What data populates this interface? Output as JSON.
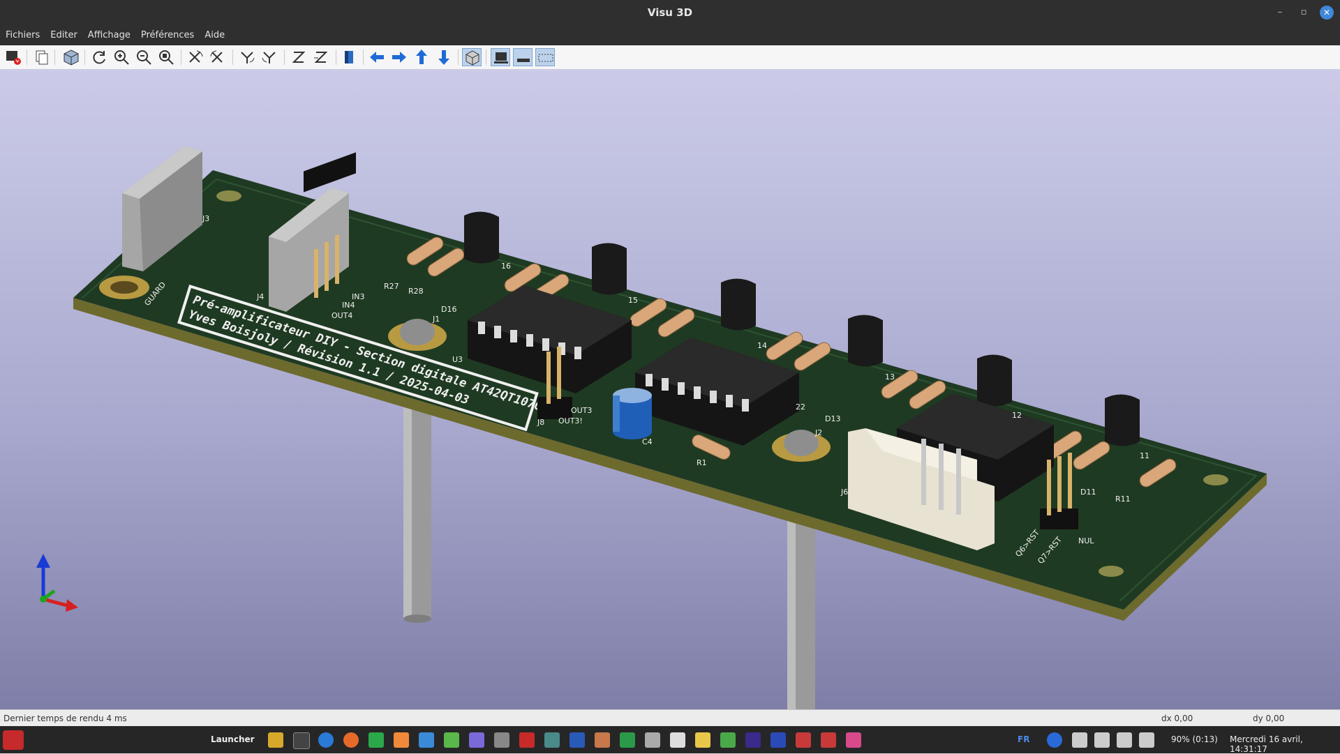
{
  "window": {
    "title": "Visu 3D",
    "minimize": "–",
    "restore": "▫",
    "close": "✕"
  },
  "menu": [
    "Fichiers",
    "Editer",
    "Affichage",
    "Préférences",
    "Aide"
  ],
  "toolbar": {
    "buttons": [
      "export-icon",
      "copy-icon",
      "view-3d-icon",
      "reload-icon",
      "zoom-in-icon",
      "zoom-out-icon",
      "zoom-fit-icon",
      "rotate-x-cw-icon",
      "rotate-x-ccw-icon",
      "rotate-y-cw-icon",
      "rotate-y-ccw-icon",
      "rotate-z-cw-icon",
      "rotate-z-ccw-icon",
      "flip-board-icon",
      "move-left-icon",
      "move-right-icon",
      "move-up-icon",
      "move-down-icon",
      "orthographic-icon",
      "render-realistic-icon",
      "render-board-icon",
      "render-bbox-icon"
    ]
  },
  "board": {
    "silkscreen_line1": "Pré-amplificateur DIY - Section digitale AT42QT1070",
    "silkscreen_line2": "Yves Boisjoly / Révision 1.1 / 2025-04-03",
    "labels": [
      "J3",
      "J4",
      "GUARD",
      "IN3",
      "IN4",
      "OUT4",
      "R27",
      "R28",
      "D16",
      "16",
      "J1",
      "U3",
      "OUT3",
      "OUT3!",
      "J8",
      "15",
      "14",
      "13",
      "12",
      "11",
      "C4",
      "R1",
      "J2",
      "D13",
      "D11",
      "R11",
      "Q6>RST",
      "Q7>RST",
      "NUL",
      "J6",
      "22"
    ],
    "colors": {
      "pcb": "#1f3a22",
      "board_edge": "#6d6a2e",
      "silk": "#f0f0f0"
    }
  },
  "status": {
    "render_time": "Dernier temps de rendu 4 ms",
    "dx": "dx 0,00",
    "dy": "dy 0,00"
  },
  "taskbar": {
    "launcher": "Launcher",
    "lang": "FR",
    "battery": "90% (0:13)",
    "datetime": "Mercredi 16 avril, 14:31:17"
  }
}
